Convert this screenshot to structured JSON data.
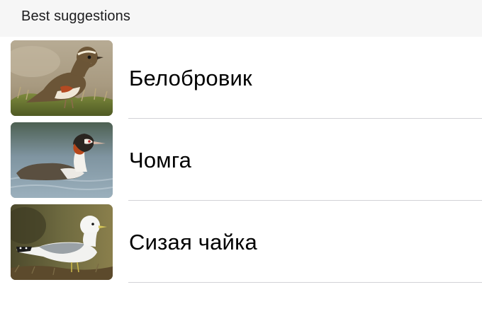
{
  "section": {
    "title": "Best suggestions"
  },
  "suggestions": [
    {
      "label": "Белобровик",
      "image": "redwing-photo"
    },
    {
      "label": "Чомга",
      "image": "great-crested-grebe-photo"
    },
    {
      "label": "Сизая чайка",
      "image": "common-gull-photo"
    }
  ],
  "colors": {
    "header_background": "#f6f6f6",
    "separator": "#d2d2d6",
    "text": "#000000"
  }
}
